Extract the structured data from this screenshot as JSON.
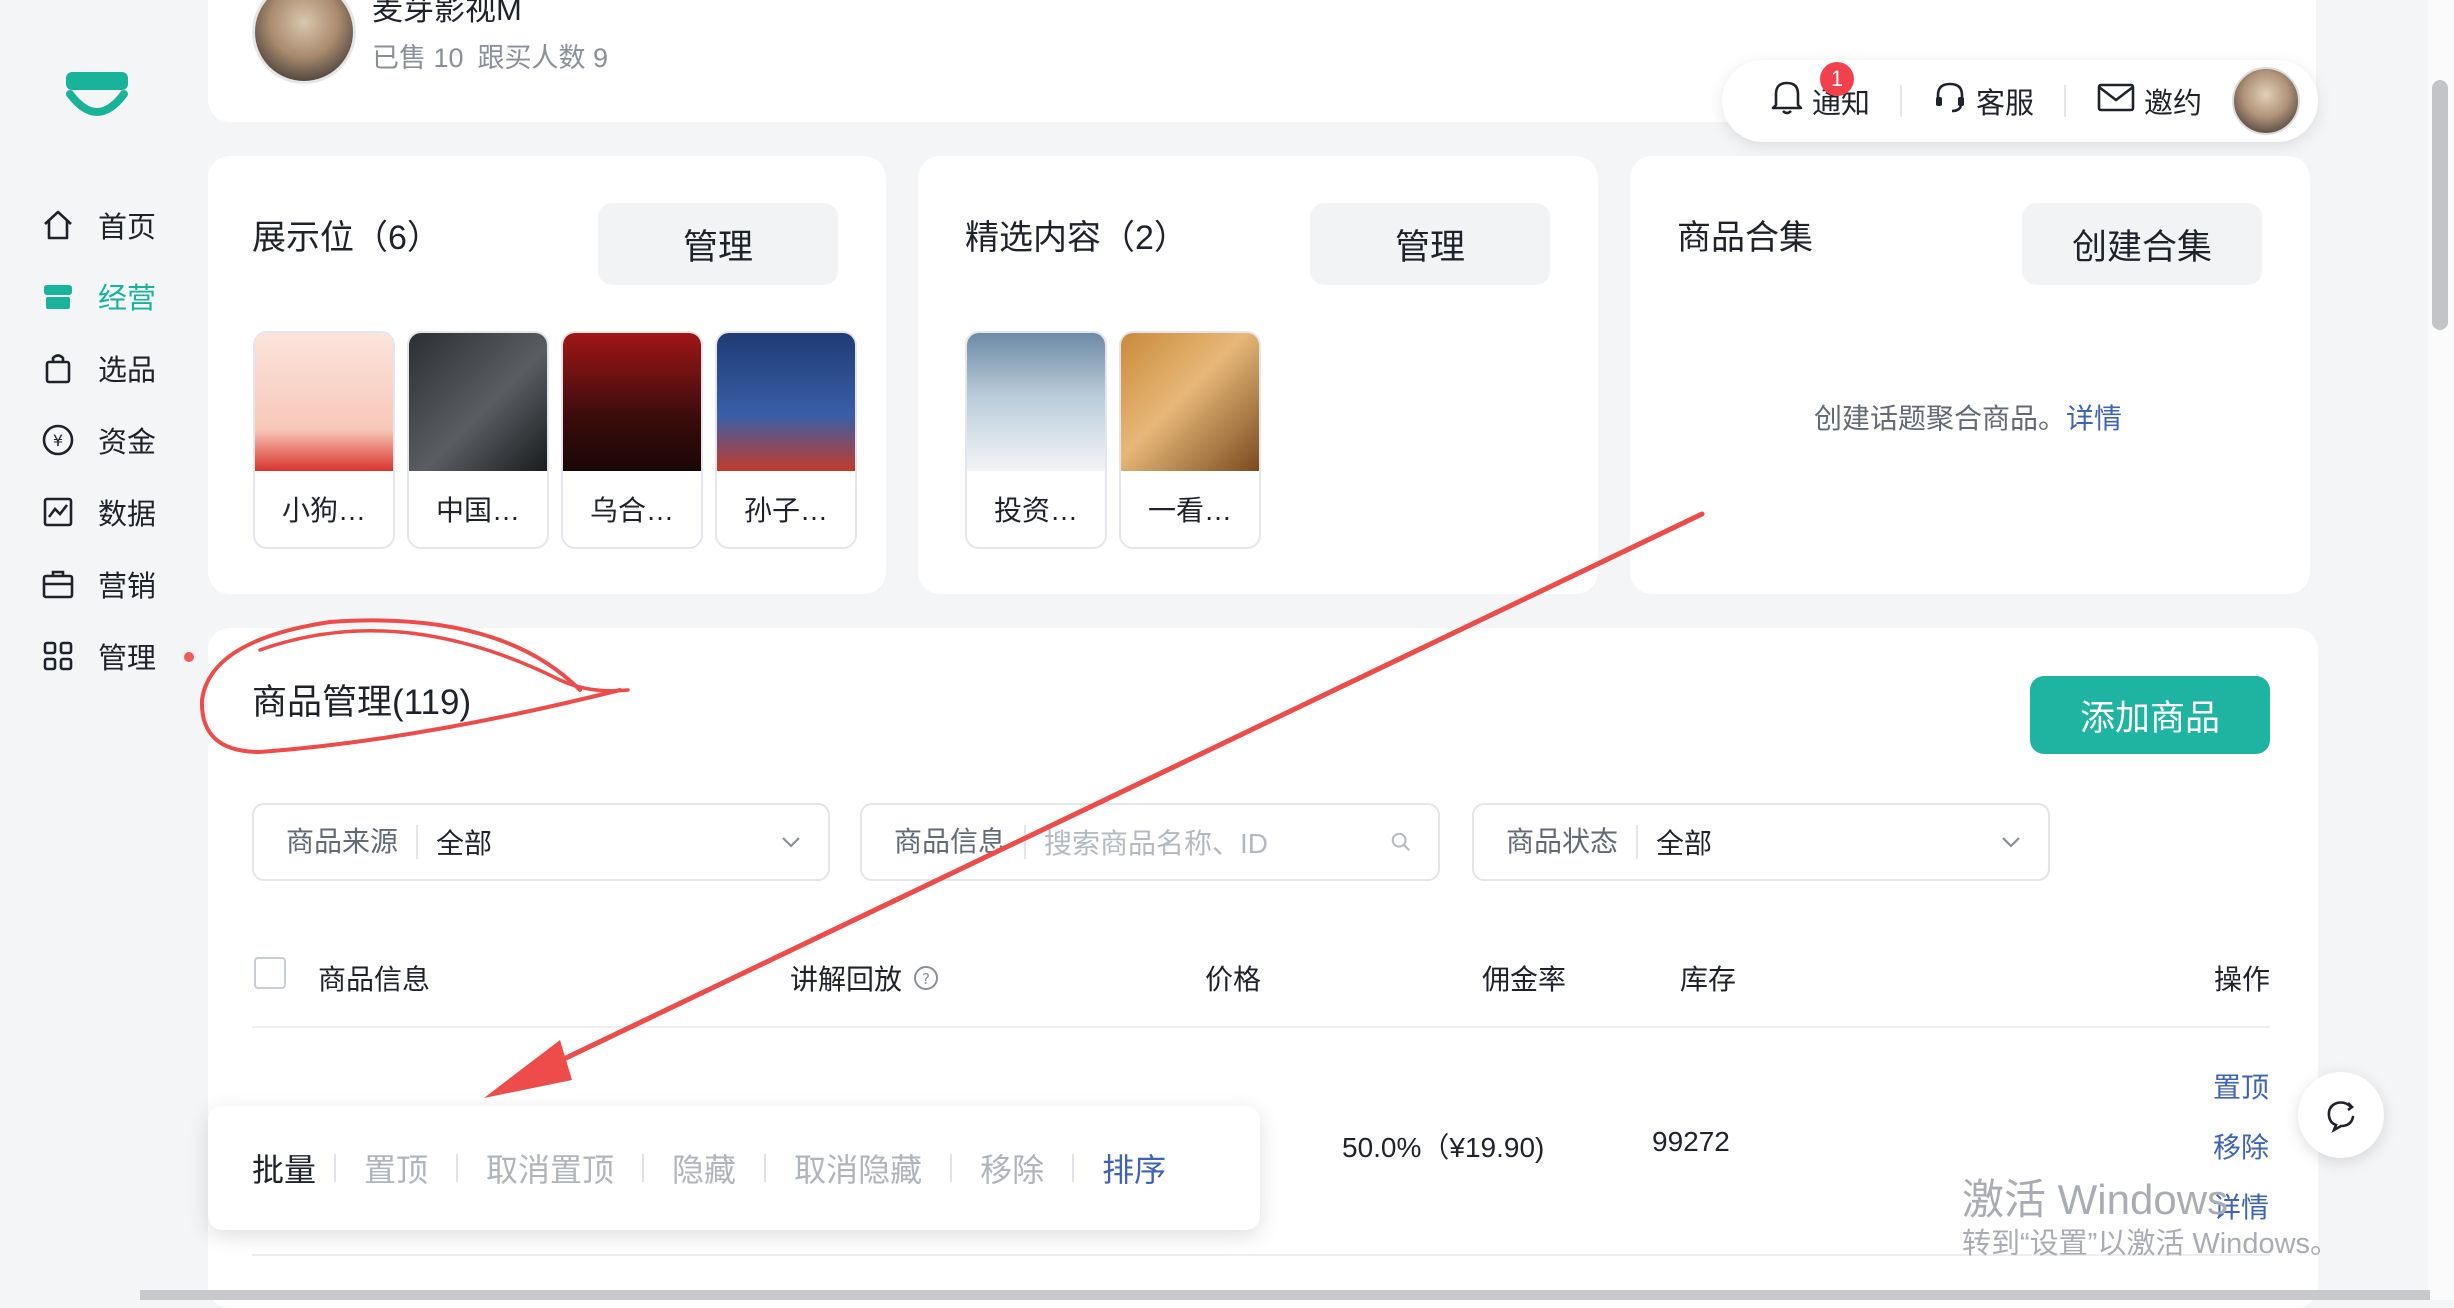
{
  "brand": {
    "accent": "#19b39a",
    "link": "#3e63b8",
    "annotation": "#ee4b4b"
  },
  "shop": {
    "name": "麦芽影视M",
    "sold": "已售 10",
    "followers": "跟买人数 9"
  },
  "toolbar": {
    "notify": "通知",
    "notify_badge": "1",
    "service": "客服",
    "invite": "邀约"
  },
  "sidebar": {
    "items": [
      {
        "label": "首页",
        "icon": "home-icon"
      },
      {
        "label": "经营",
        "icon": "store-icon"
      },
      {
        "label": "选品",
        "icon": "bag-icon"
      },
      {
        "label": "资金",
        "icon": "yuan-icon"
      },
      {
        "label": "数据",
        "icon": "chart-icon"
      },
      {
        "label": "营销",
        "icon": "briefcase-icon"
      },
      {
        "label": "管理",
        "icon": "grid-icon"
      }
    ]
  },
  "showcase": {
    "title": "展示位（6）",
    "button": "管理",
    "items": [
      "小狗…",
      "中国…",
      "乌合…",
      "孙子…"
    ]
  },
  "featured": {
    "title": "精选内容（2）",
    "button": "管理",
    "items": [
      "投资…",
      "一看…"
    ]
  },
  "collection": {
    "title": "商品合集",
    "button": "创建合集",
    "empty_text": "创建话题聚合商品。",
    "empty_link": "详情"
  },
  "product_mgmt": {
    "title": "商品管理(119)",
    "add_button": "添加商品",
    "filters": {
      "source_label": "商品来源",
      "source_value": "全部",
      "info_label": "商品信息",
      "info_placeholder": "搜索商品名称、ID",
      "status_label": "商品状态",
      "status_value": "全部"
    },
    "columns": [
      "商品信息",
      "讲解回放",
      "价格",
      "佣金率",
      "库存",
      "操作"
    ],
    "rows": [
      {
        "commission": "50.0%（¥19.90)",
        "stock": "99272",
        "actions": [
          "置顶",
          "移除",
          "详情"
        ]
      }
    ]
  },
  "batch_bar": {
    "label": "批量",
    "actions": [
      "置顶",
      "取消置顶",
      "隐藏",
      "取消隐藏",
      "移除"
    ],
    "sort": "排序"
  },
  "watermark": {
    "line1": "激活 Windows",
    "line2": "转到“设置”以激活 Windows。"
  }
}
